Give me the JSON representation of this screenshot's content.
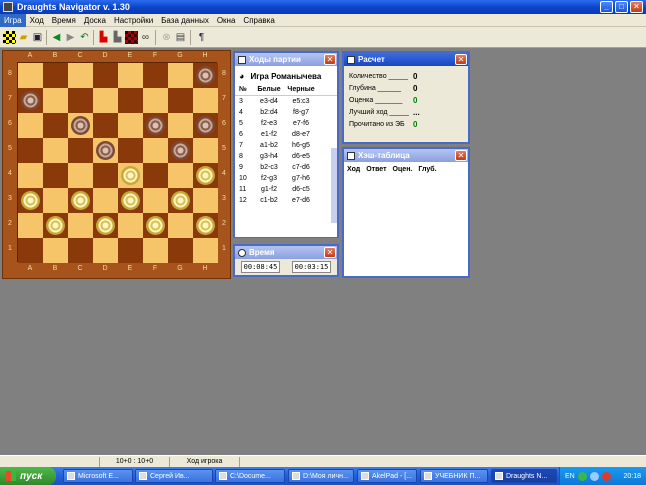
{
  "window": {
    "title": "Draughts Navigator v. 1.30",
    "minimize": "_",
    "maximize": "□",
    "close": "✕"
  },
  "menu": [
    "Игра",
    "Ход",
    "Время",
    "Доска",
    "Настройки",
    "База данных",
    "Окна",
    "Справка"
  ],
  "toolbar": [
    "new-game-icon",
    "open-icon",
    "save-icon",
    "back-icon",
    "forward-icon",
    "undo-icon",
    "red-flag-icon",
    "black-flag-icon",
    "checkered-icon",
    "binoculars-icon",
    "stop-icon",
    "screen-icon",
    "help-icon"
  ],
  "board": {
    "files": [
      "A",
      "B",
      "C",
      "D",
      "E",
      "F",
      "G",
      "H"
    ],
    "ranks": [
      "8",
      "7",
      "6",
      "5",
      "4",
      "3",
      "2",
      "1"
    ],
    "pieces": [
      {
        "sq": "a7",
        "color": "black"
      },
      {
        "sq": "h8",
        "color": "black"
      },
      {
        "sq": "c6",
        "color": "black"
      },
      {
        "sq": "f6",
        "color": "black"
      },
      {
        "sq": "h6",
        "color": "black"
      },
      {
        "sq": "d5",
        "color": "black"
      },
      {
        "sq": "g5",
        "color": "black"
      },
      {
        "sq": "e4",
        "color": "white"
      },
      {
        "sq": "h4",
        "color": "white"
      },
      {
        "sq": "a3",
        "color": "white"
      },
      {
        "sq": "c3",
        "color": "white"
      },
      {
        "sq": "e3",
        "color": "white"
      },
      {
        "sq": "g3",
        "color": "white"
      },
      {
        "sq": "b2",
        "color": "white"
      },
      {
        "sq": "d2",
        "color": "white"
      },
      {
        "sq": "f2",
        "color": "white"
      },
      {
        "sq": "h2",
        "color": "white"
      }
    ]
  },
  "moves": {
    "title": "Ходы партии",
    "game": "Игра Романычева",
    "headers": [
      "№",
      "Белые",
      "Черные"
    ],
    "rows": [
      [
        "3",
        "e3-d4",
        "e5:c3"
      ],
      [
        "4",
        "b2:d4",
        "f8-g7"
      ],
      [
        "5",
        "f2-e3",
        "e7-f6"
      ],
      [
        "6",
        "e1-f2",
        "d8-e7"
      ],
      [
        "7",
        "a1-b2",
        "h6-g5"
      ],
      [
        "8",
        "g3-h4",
        "d6-e5"
      ],
      [
        "9",
        "b2-c3",
        "c7-d6"
      ],
      [
        "10",
        "f2-g3",
        "g7-h6"
      ],
      [
        "11",
        "g1-f2",
        "d6-c5"
      ],
      [
        "12",
        "c1-b2",
        "e7-d6"
      ]
    ]
  },
  "time": {
    "title": "Время",
    "white": "00:08:45",
    "black": "00:03:15"
  },
  "calc": {
    "title": "Расчет",
    "rows": [
      {
        "label": "Количество _____",
        "value": "0",
        "color": "#000000"
      },
      {
        "label": "Глубина ______",
        "value": "0",
        "color": "#000000"
      },
      {
        "label": "Оценка _______",
        "value": "0",
        "color": "#008000"
      },
      {
        "label": "Лучший ход _____",
        "value": "...",
        "color": "#000000"
      },
      {
        "label": "Прочитано из ЭБ",
        "value": "0",
        "color": "#008000"
      }
    ]
  },
  "hash": {
    "title": "Хэш-таблица",
    "headers": [
      "Ход",
      "Ответ",
      "Оцен.",
      "Глуб."
    ]
  },
  "status": {
    "score": "10+0 : 10+0",
    "mode": "Ход игрока"
  },
  "taskbar": {
    "start": "пуск",
    "tasks": [
      "Microsoft E...",
      "Сергей Ив...",
      "C:\\Docume...",
      "D:\\Моя личн...",
      "AkelPad - [...",
      "УЧЕБНИК П...",
      "Draughts N..."
    ],
    "lang": "EN",
    "clock": "20:18"
  },
  "colors": {
    "title": "#0a44c8",
    "board_light": "#f6c56a",
    "board_dark": "#8a3a0a",
    "frame": "#a7541c"
  }
}
